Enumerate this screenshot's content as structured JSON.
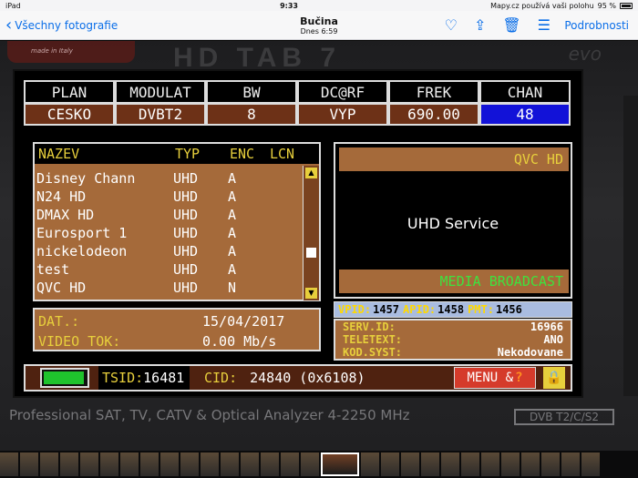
{
  "ios": {
    "status": {
      "device": "iPad",
      "time": "9:33",
      "location_note": "Mapy.cz používá vaši polohu",
      "battery": "95 %"
    },
    "nav": {
      "back_label": "Všechny fotografie",
      "title": "Bučina",
      "subtitle": "Dnes  6:59",
      "details_label": "Podrobnosti"
    }
  },
  "device": {
    "model": "HD TAB 7",
    "model_suffix": "evo",
    "brand_sub": "made in Italy",
    "footer": "Professional SAT, TV, CATV & Optical Analyzer 4-2250 MHz",
    "dvb_logo": "DVB T2/C/S2"
  },
  "table": {
    "headers": [
      "PLAN",
      "MODULAT",
      "BW",
      "DC@RF",
      "FREK",
      "CHAN"
    ],
    "values": [
      "CESKO",
      "DVBT2",
      "8",
      "VYP",
      "690.00",
      "48"
    ]
  },
  "list": {
    "header": {
      "name": "NAZEV",
      "type": "TYP",
      "enc": "ENC",
      "lcn": "LCN"
    },
    "rows": [
      {
        "name": "Disney Chann",
        "type": "UHD",
        "enc": "A"
      },
      {
        "name": "N24 HD",
        "type": "UHD",
        "enc": "A"
      },
      {
        "name": "DMAX HD",
        "type": "UHD",
        "enc": "A"
      },
      {
        "name": "Eurosport 1",
        "type": "UHD",
        "enc": "A"
      },
      {
        "name": "nickelodeon",
        "type": "UHD",
        "enc": "A"
      },
      {
        "name": "test",
        "type": "UHD",
        "enc": "A"
      },
      {
        "name": "QVC HD",
        "type": "UHD",
        "enc": "N"
      }
    ]
  },
  "info": {
    "date_label": "DAT.:",
    "date": "15/04/2017",
    "bitrate_label": "VIDEO TOK:",
    "bitrate": "0.00 Mb/s"
  },
  "preview": {
    "channel": "QVC HD",
    "service": "UHD Service",
    "provider": "MEDIA BROADCAST"
  },
  "pids": {
    "vpid_label": "VPID:",
    "vpid": "1457",
    "apid_label": "APID:",
    "apid": "1458",
    "pmt_label": "PMT:",
    "pmt": "1456"
  },
  "serv": {
    "id_label": "SERV.ID:",
    "id": "16966",
    "teletext_label": "TELETEXT:",
    "teletext": "ANO",
    "cas_label": "KOD.SYST:",
    "cas": "Nekodovane"
  },
  "bottom": {
    "tsid_label": "TSID:",
    "tsid": "16481",
    "cid_label": "CID:",
    "cid": "24840 (0x6108)",
    "menu_label": "MENU &",
    "menu_q": "?"
  }
}
